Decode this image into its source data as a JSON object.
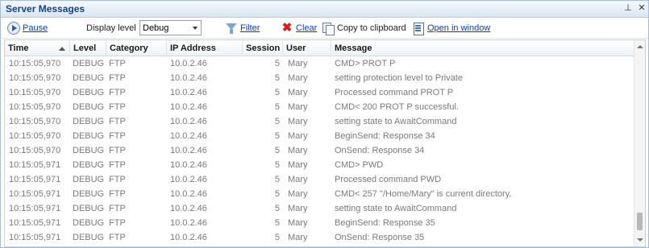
{
  "panel": {
    "title": "Server Messages",
    "pin_glyph": "⊥",
    "close_glyph": "✕"
  },
  "toolbar": {
    "pause_label": "Pause",
    "display_level_label": "Display level",
    "display_level_value": "Debug",
    "filter_label": "Filter",
    "clear_label": "Clear",
    "copy_label": "Copy to clipboard",
    "open_window_label": "Open in window",
    "clear_glyph": "✖"
  },
  "icons": {
    "pause": "pause-icon",
    "filter": "filter-icon",
    "clear": "clear-icon",
    "copy": "copy-icon",
    "window": "window-icon",
    "pin": "pin-icon",
    "close": "close-icon"
  },
  "colors": {
    "link": "#0b3fae",
    "title": "#15428b",
    "row_text": "#7a7a7a",
    "clear": "#d41f1f"
  },
  "table": {
    "columns": [
      "Time",
      "Level",
      "Category",
      "IP Address",
      "Session",
      "User",
      "Message"
    ],
    "rows": [
      [
        "10:15:05,970",
        "DEBUG",
        "FTP",
        "10.0.2.46",
        "5",
        "Mary",
        "CMD> PROT P"
      ],
      [
        "10:15:05,970",
        "DEBUG",
        "FTP",
        "10.0.2.46",
        "5",
        "Mary",
        "setting protection level to Private"
      ],
      [
        "10:15:05,970",
        "DEBUG",
        "FTP",
        "10.0.2.46",
        "5",
        "Mary",
        "Processed command PROT P"
      ],
      [
        "10:15:05,970",
        "DEBUG",
        "FTP",
        "10.0.2.46",
        "5",
        "Mary",
        "CMD< 200 PROT P successful."
      ],
      [
        "10:15:05,970",
        "DEBUG",
        "FTP",
        "10.0.2.46",
        "5",
        "Mary",
        "setting state to AwaitCommand"
      ],
      [
        "10:15:05,970",
        "DEBUG",
        "FTP",
        "10.0.2.46",
        "5",
        "Mary",
        "BeginSend: Response 34"
      ],
      [
        "10:15:05,970",
        "DEBUG",
        "FTP",
        "10.0.2.46",
        "5",
        "Mary",
        "OnSend: Response 34"
      ],
      [
        "10:15:05,971",
        "DEBUG",
        "FTP",
        "10.0.2.46",
        "5",
        "Mary",
        "CMD> PWD"
      ],
      [
        "10:15:05,971",
        "DEBUG",
        "FTP",
        "10.0.2.46",
        "5",
        "Mary",
        "Processed command PWD"
      ],
      [
        "10:15:05,971",
        "DEBUG",
        "FTP",
        "10.0.2.46",
        "5",
        "Mary",
        "CMD< 257 \"/Home/Mary\" is current directory."
      ],
      [
        "10:15:05,971",
        "DEBUG",
        "FTP",
        "10.0.2.46",
        "5",
        "Mary",
        "setting state to AwaitCommand"
      ],
      [
        "10:15:05,971",
        "DEBUG",
        "FTP",
        "10.0.2.46",
        "5",
        "Mary",
        "BeginSend: Response 35"
      ],
      [
        "10:15:05,971",
        "DEBUG",
        "FTP",
        "10.0.2.46",
        "5",
        "Mary",
        "OnSend: Response 35"
      ]
    ]
  }
}
